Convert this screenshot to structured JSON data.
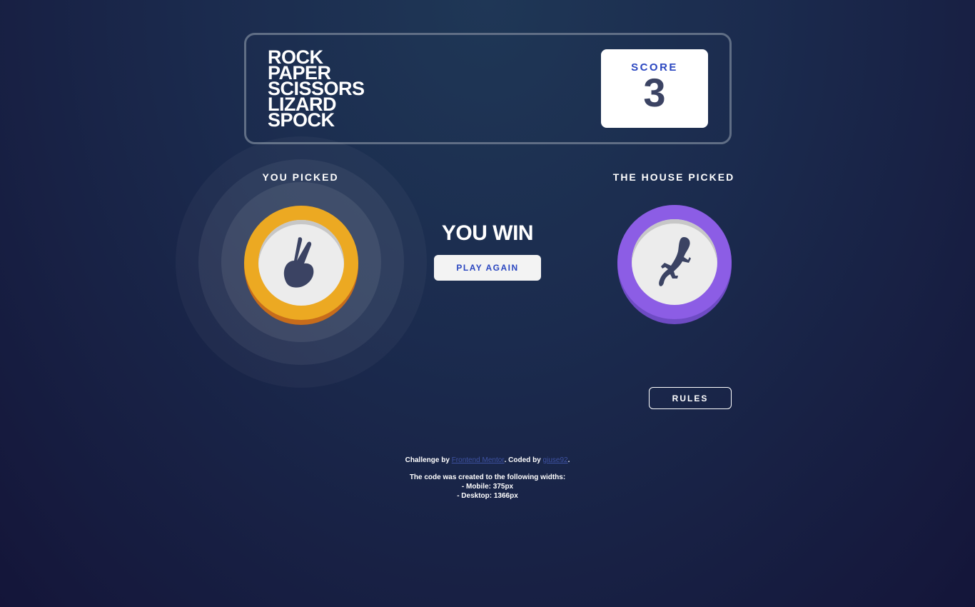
{
  "header": {
    "title_lines": [
      "ROCK",
      "PAPER",
      "SCISSORS",
      "LIZARD",
      "SPOCK"
    ],
    "score_label": "SCORE",
    "score_value": "3"
  },
  "player": {
    "label": "YOU PICKED",
    "pick": "scissors",
    "icon": "scissors-hand-icon",
    "color": "#eca922"
  },
  "house": {
    "label": "THE HOUSE PICKED",
    "pick": "lizard",
    "icon": "lizard-icon",
    "color": "#8c5de5"
  },
  "result": {
    "text": "YOU WIN",
    "play_again_label": "PLAY AGAIN"
  },
  "rules_label": "RULES",
  "footer": {
    "challenge_prefix": "Challenge by",
    "challenge_link": "Frontend Mentor",
    "coded_prefix": ". Coded by",
    "coded_link": "giuse92",
    "coded_suffix": ".",
    "widths_title": "The code was created to the following widths:",
    "mobile": "- Mobile: 375px",
    "desktop": "- Desktop: 1366px"
  }
}
